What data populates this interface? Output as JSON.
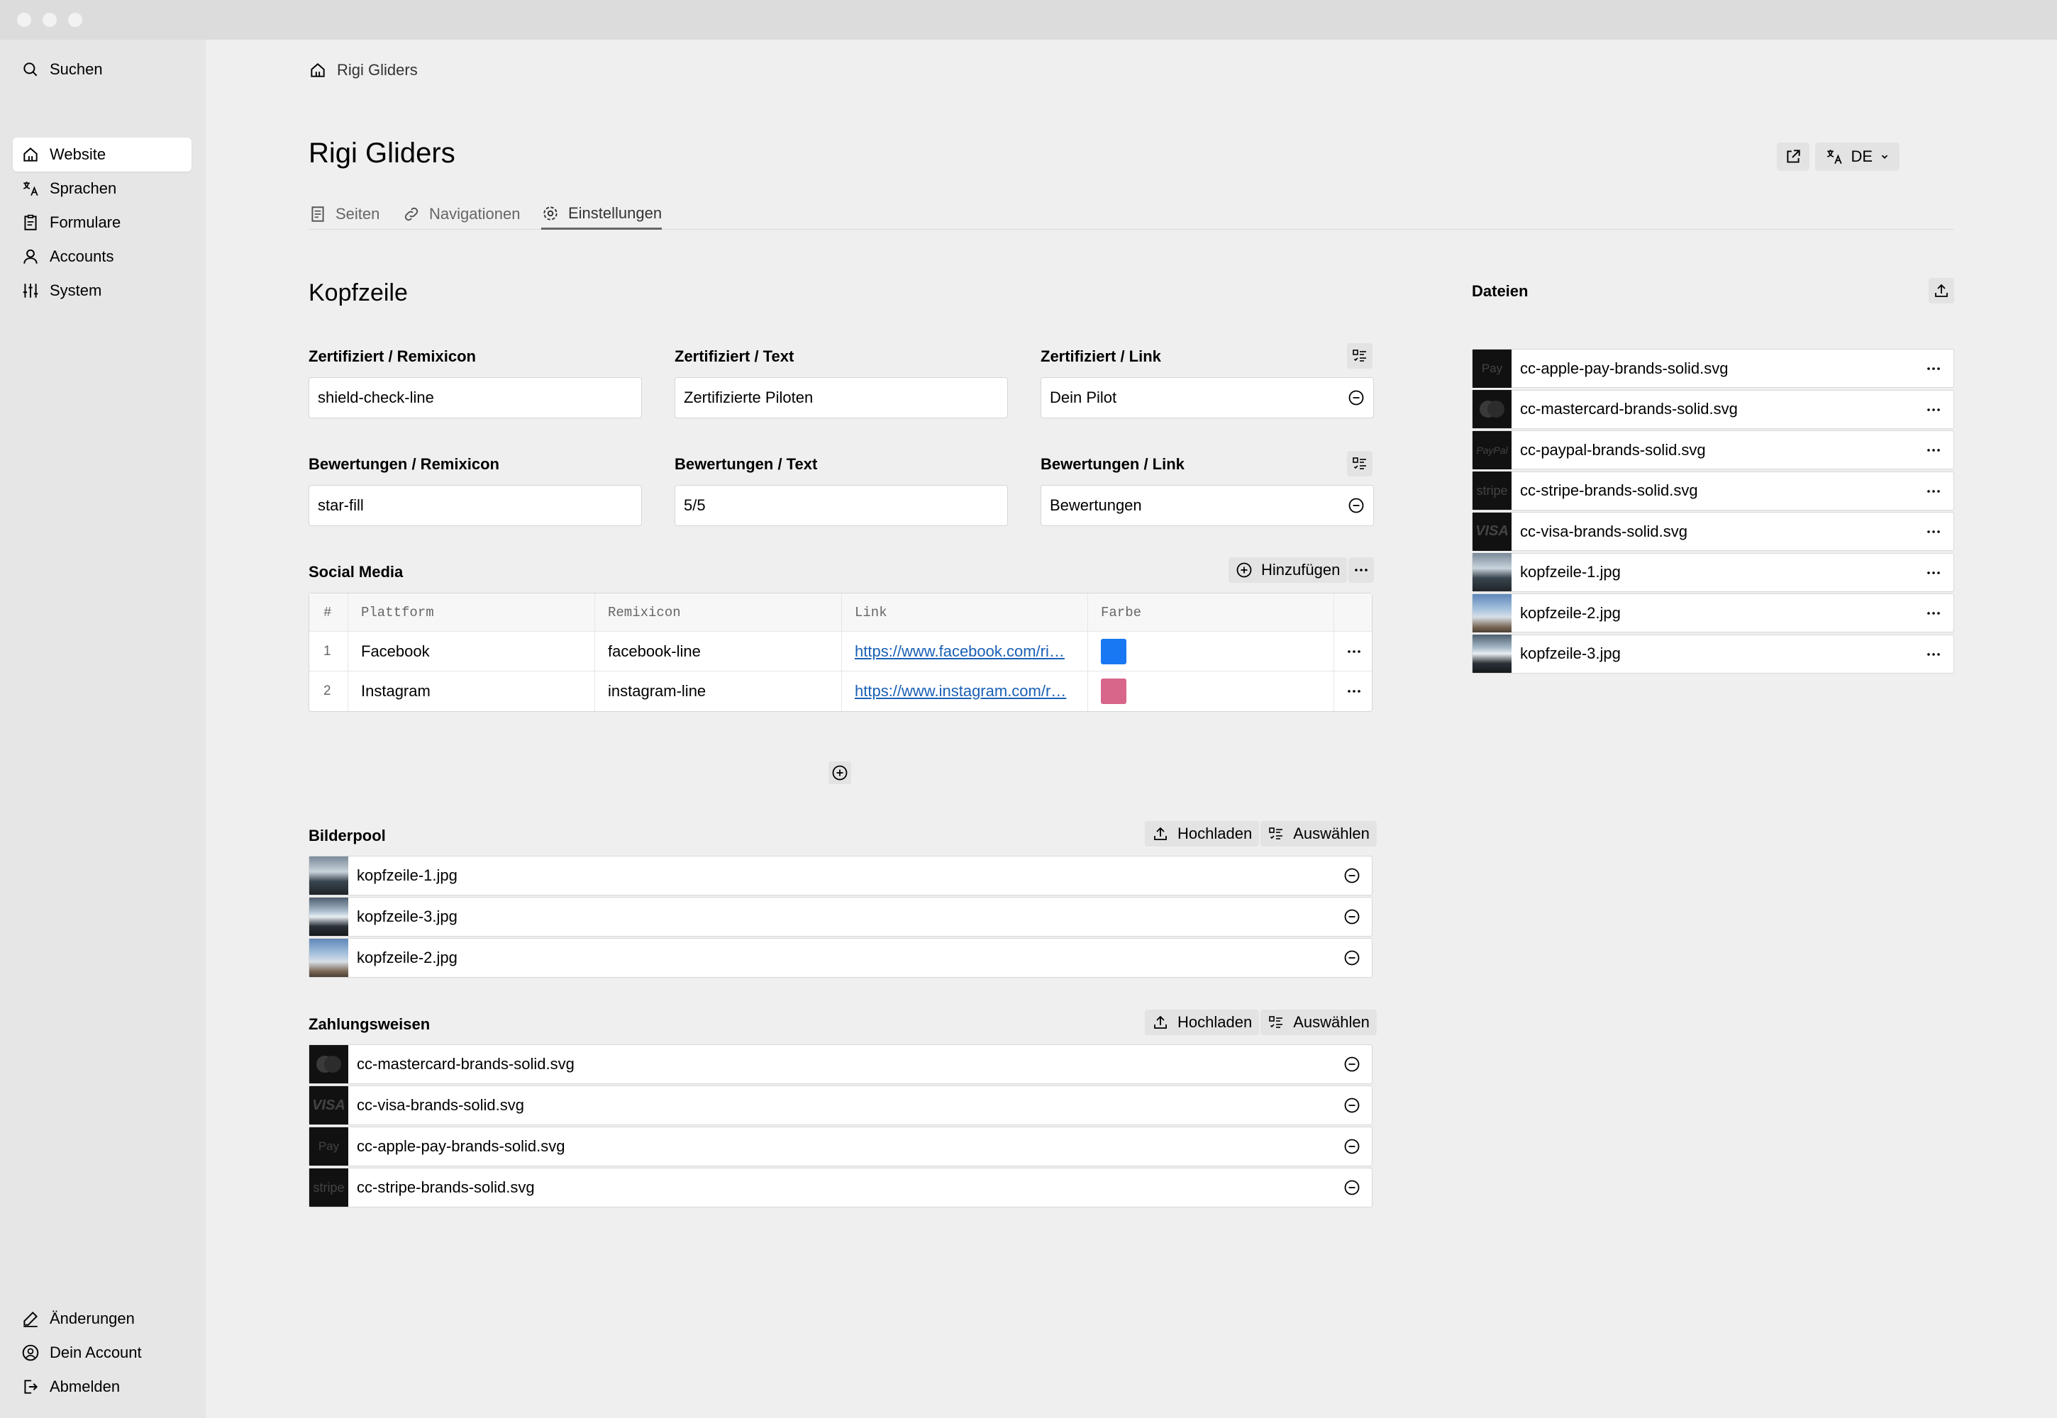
{
  "sidebar": {
    "search": "Suchen",
    "items": [
      {
        "label": "Website",
        "icon": "home-icon",
        "active": true
      },
      {
        "label": "Sprachen",
        "icon": "translate-icon"
      },
      {
        "label": "Formulare",
        "icon": "clipboard-icon"
      },
      {
        "label": "Accounts",
        "icon": "user-icon"
      },
      {
        "label": "System",
        "icon": "sliders-icon"
      }
    ],
    "bottom": [
      {
        "label": "Änderungen",
        "icon": "pencil-icon"
      },
      {
        "label": "Dein Account",
        "icon": "account-circle-icon"
      },
      {
        "label": "Abmelden",
        "icon": "logout-icon"
      }
    ]
  },
  "breadcrumb": "Rigi Gliders",
  "page_title": "Rigi Gliders",
  "language": "DE",
  "tabs": [
    {
      "label": "Seiten",
      "icon": "pages-icon"
    },
    {
      "label": "Navigationen",
      "icon": "link-icon"
    },
    {
      "label": "Einstellungen",
      "icon": "settings-icon",
      "active": true
    }
  ],
  "section_title": "Kopfzeile",
  "fields": {
    "cert_remixicon": {
      "label": "Zertifiziert / Remixicon",
      "value": "shield-check-line"
    },
    "cert_text": {
      "label": "Zertifiziert / Text",
      "value": "Zertifizierte Piloten"
    },
    "cert_link": {
      "label": "Zertifiziert / Link",
      "value": "Dein Pilot"
    },
    "rating_remixicon": {
      "label": "Bewertungen / Remixicon",
      "value": "star-fill"
    },
    "rating_text": {
      "label": "Bewertungen / Text",
      "value": "5/5"
    },
    "rating_link": {
      "label": "Bewertungen / Link",
      "value": "Bewertungen"
    }
  },
  "social": {
    "title": "Social Media",
    "add_label": "Hinzufügen",
    "columns": [
      "#",
      "Plattform",
      "Remixicon",
      "Link",
      "Farbe"
    ],
    "rows": [
      {
        "num": "1",
        "platform": "Facebook",
        "icon": "facebook-line",
        "link": "https://www.facebook.com/ri…",
        "color": "#1877f2"
      },
      {
        "num": "2",
        "platform": "Instagram",
        "icon": "instagram-line",
        "link": "https://www.instagram.com/r…",
        "color": "#d8658a"
      }
    ]
  },
  "bilderpool": {
    "title": "Bilderpool",
    "upload": "Hochladen",
    "select": "Auswählen",
    "items": [
      "kopfzeile-1.jpg",
      "kopfzeile-3.jpg",
      "kopfzeile-2.jpg"
    ]
  },
  "zahlungsweisen": {
    "title": "Zahlungsweisen",
    "upload": "Hochladen",
    "select": "Auswählen",
    "items": [
      "cc-mastercard-brands-solid.svg",
      "cc-visa-brands-solid.svg",
      "cc-apple-pay-brands-solid.svg",
      "cc-stripe-brands-solid.svg"
    ]
  },
  "dateien": {
    "title": "Dateien",
    "items": [
      "cc-apple-pay-brands-solid.svg",
      "cc-mastercard-brands-solid.svg",
      "cc-paypal-brands-solid.svg",
      "cc-stripe-brands-solid.svg",
      "cc-visa-brands-solid.svg",
      "kopfzeile-1.jpg",
      "kopfzeile-2.jpg",
      "kopfzeile-3.jpg"
    ]
  },
  "thumb_text": {
    "apple": "Pay",
    "paypal": "PayPal",
    "stripe": "stripe",
    "visa": "VISA"
  }
}
